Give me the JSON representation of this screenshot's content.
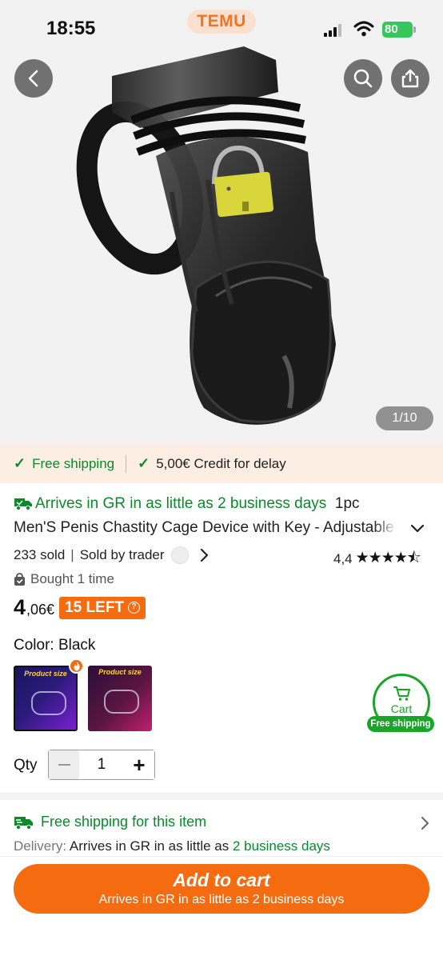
{
  "status_bar": {
    "time": "18:55",
    "app_name": "TEMU",
    "battery": "80"
  },
  "hero": {
    "image_counter": "1/10",
    "icons": [
      "back-icon",
      "search-icon",
      "share-icon"
    ]
  },
  "promo": {
    "free_shipping": "Free shipping",
    "credit": "5,00€ Credit for delay"
  },
  "product": {
    "arrives": "Arrives in GR in as little as 2 business days",
    "pack": "1pc",
    "title": "Men'S Penis Chastity Cage Device with Key - Adjustable",
    "sold": "233 sold",
    "sold_by": "Sold by trader",
    "rating_value": "4,4",
    "rating_stars": 4.4,
    "bought": "Bought 1 time",
    "price_main": "4",
    "price_decimal": ",06€",
    "stock_badge": "15 LEFT",
    "color_label": "Color: Black",
    "swatch_title": "Product size"
  },
  "cart_float": {
    "label": "Cart",
    "badge": "Free shipping"
  },
  "quantity": {
    "label": "Qty",
    "value": "1"
  },
  "shipping": {
    "title": "Free shipping for this item",
    "delivery_label": "Delivery:",
    "delivery_text": "Arrives in GR in as little as",
    "delivery_days": "2 business days"
  },
  "bottom": {
    "add_to_cart": "Add to cart",
    "add_sub": "Arrives in GR in as little as 2 business days"
  },
  "colors": {
    "accent": "#f56b0f",
    "green": "#0a8a2a",
    "promo_bg": "#fdeee3"
  }
}
